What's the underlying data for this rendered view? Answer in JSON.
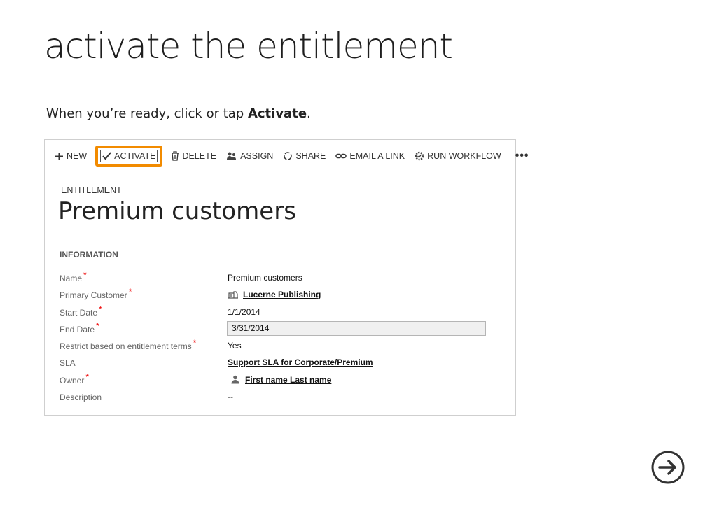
{
  "title": "activate the entitlement",
  "instruction": {
    "prefix": "When you’re ready, click or tap ",
    "bold": "Activate",
    "suffix": "."
  },
  "toolbar": {
    "new": "NEW",
    "activate": "ACTIVATE",
    "delete": "DELETE",
    "assign": "ASSIGN",
    "share": "SHARE",
    "email": "EMAIL A LINK",
    "workflow": "RUN WORKFLOW",
    "more": "•••"
  },
  "record": {
    "entity_type": "ENTITLEMENT",
    "name": "Premium customers"
  },
  "section_title": "INFORMATION",
  "fields": {
    "name": {
      "label": "Name",
      "value": "Premium customers"
    },
    "primary_customer": {
      "label": "Primary Customer",
      "value": "Lucerne Publishing"
    },
    "start_date": {
      "label": "Start Date",
      "value": "1/1/2014"
    },
    "end_date": {
      "label": "End Date",
      "value": "3/31/2014"
    },
    "restrict": {
      "label": "Restrict based on entitlement terms",
      "value": "Yes"
    },
    "sla": {
      "label": "SLA",
      "value": "Support SLA for Corporate/Premium"
    },
    "owner": {
      "label": "Owner",
      "value": "First name Last name"
    },
    "description": {
      "label": "Description",
      "value": "--"
    }
  },
  "required_mark": "*",
  "colors": {
    "highlight": "#f28b00",
    "required": "#ee0000"
  }
}
